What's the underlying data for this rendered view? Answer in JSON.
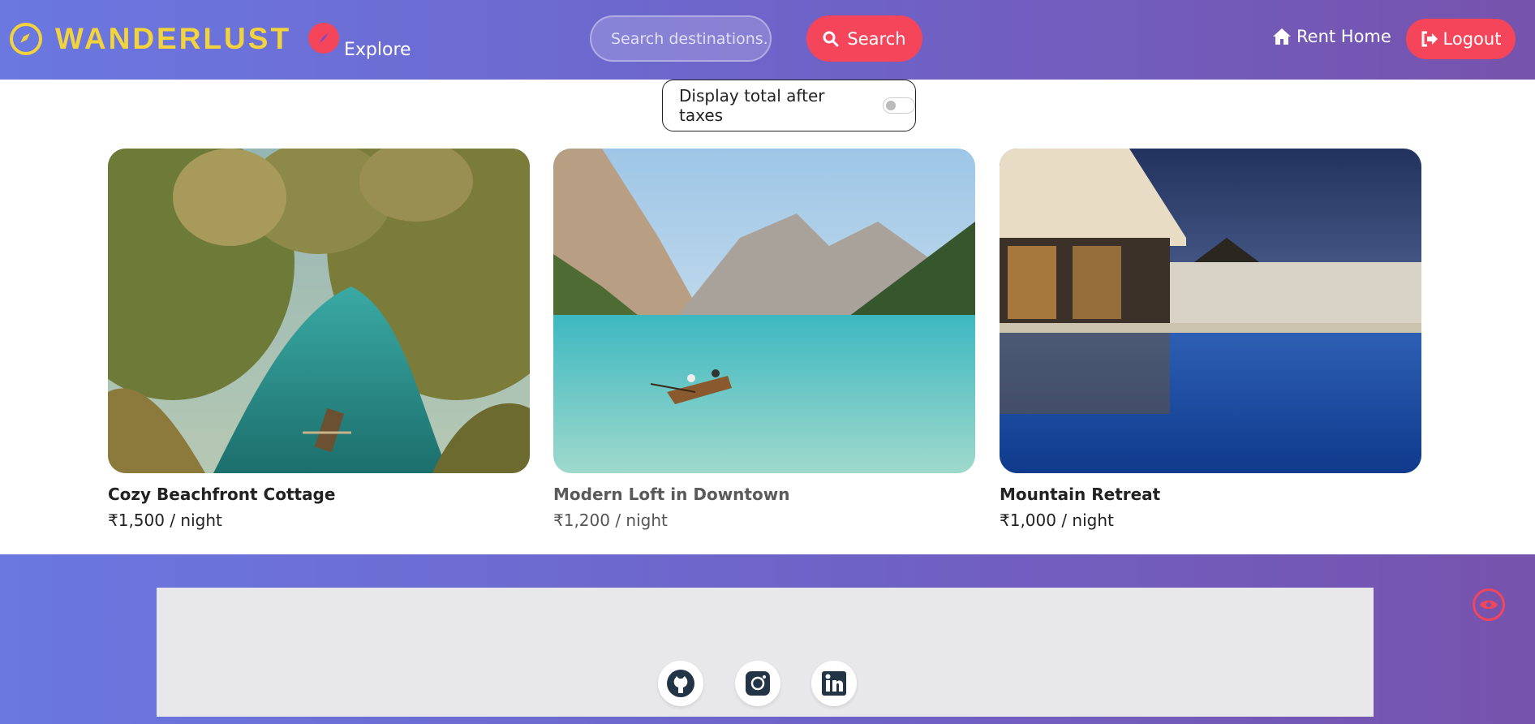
{
  "navbar": {
    "brand": "WANDERLUST",
    "explore_label": "Explore",
    "search_placeholder": "Search destinations..",
    "search_label": "Search",
    "rent_home_label": "Rent Home",
    "logout_label": "Logout"
  },
  "tax_toggle": {
    "label": "Display total after taxes",
    "enabled": false
  },
  "listings": [
    {
      "title": "Cozy Beachfront Cottage",
      "price": "₹1,500 / night"
    },
    {
      "title": "Modern Loft in Downtown",
      "price": "₹1,200 / night"
    },
    {
      "title": "Mountain Retreat",
      "price": "₹1,000 / night"
    }
  ],
  "footer": {
    "social_icons": [
      "github-icon",
      "instagram-icon",
      "linkedin-icon"
    ]
  },
  "colors": {
    "accent": "#f5455a",
    "brand": "#f3d33c",
    "gradient_start": "#6a78e0",
    "gradient_end": "#7653ad"
  }
}
